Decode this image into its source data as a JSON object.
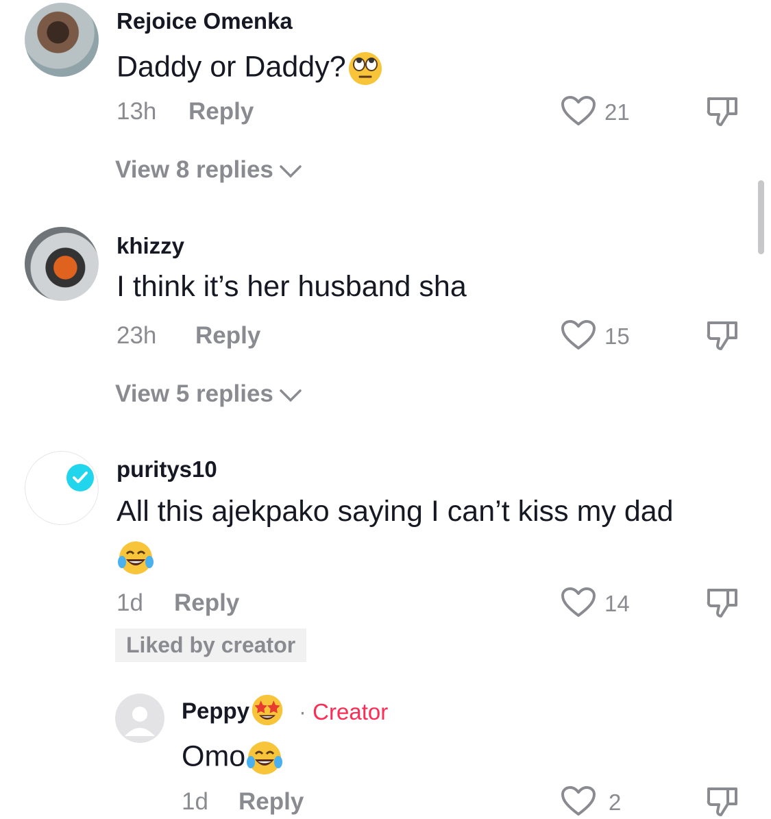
{
  "comments": [
    {
      "username": "Rejoice Omenka",
      "text": "Daddy or Daddy?",
      "emoji": "face-with-rolling-eyes",
      "time": "13h",
      "reply_label": "Reply",
      "likes": "21",
      "view_replies": "View 8 replies"
    },
    {
      "username": "khizzy",
      "text": "I think it’s her husband sha",
      "time": "23h",
      "reply_label": "Reply",
      "likes": "15",
      "view_replies": "View 5 replies"
    },
    {
      "username": "puritys10",
      "verified": true,
      "text": "All this ajekpako saying I can’t kiss my dad",
      "emoji": "face-with-tears-of-joy",
      "time": "1d",
      "reply_label": "Reply",
      "likes": "14",
      "badge": "Liked by creator"
    }
  ],
  "reply": {
    "username": "Peppy",
    "username_emoji": "star-struck",
    "separator": "·",
    "role_tag": "Creator",
    "text": "Omo",
    "emoji": "face-with-tears-of-joy",
    "time": "1d",
    "reply_label": "Reply",
    "likes": "2"
  },
  "colors": {
    "text": "#161823",
    "meta": "#8a8b91",
    "creator": "#fe2c55",
    "verified": "#20d5ec",
    "badge_bg": "#f1f1f2"
  }
}
